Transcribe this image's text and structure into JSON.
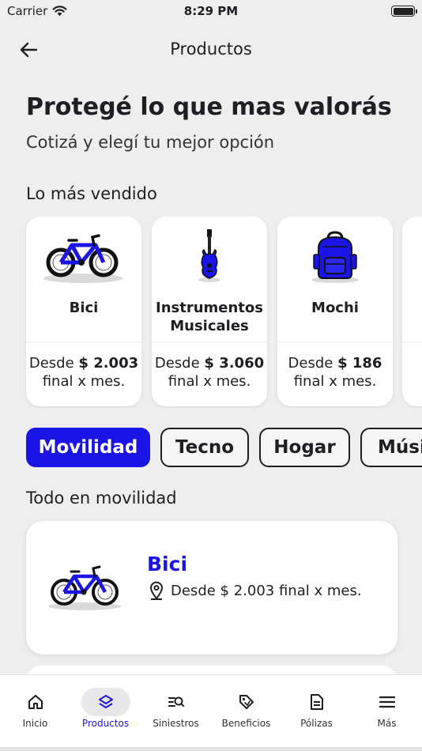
{
  "status_bar": {
    "carrier": "Carrier",
    "time": "8:29 PM"
  },
  "nav": {
    "title": "Productos"
  },
  "header": {
    "headline": "Protegé lo que mas valorás",
    "subheadline": "Cotizá y elegí tu mejor opción"
  },
  "best_sellers": {
    "title": "Lo más vendido",
    "items": [
      {
        "name": "Bici",
        "desde": "Desde",
        "price": "$ 2.003",
        "suffix": "final x mes."
      },
      {
        "name": "Instrumentos Musicales",
        "desde": "Desde",
        "price": "$ 3.060",
        "suffix": "final x mes."
      },
      {
        "name": "Mochi",
        "desde": "Desde",
        "price": "$ 186",
        "suffix": "final x mes."
      }
    ]
  },
  "categories": {
    "items": [
      {
        "label": "Movilidad",
        "active": true
      },
      {
        "label": "Tecno",
        "active": false
      },
      {
        "label": "Hogar",
        "active": false
      },
      {
        "label": "Músi",
        "active": false
      }
    ]
  },
  "category_section": {
    "title": "Todo en movilidad",
    "products": [
      {
        "name": "Bici",
        "description": "Desde $ 2.003 final x mes."
      }
    ]
  },
  "tab_bar": {
    "items": [
      {
        "label": "Inicio",
        "icon": "home-icon",
        "active": false
      },
      {
        "label": "Productos",
        "icon": "layers-icon",
        "active": true
      },
      {
        "label": "Siniestros",
        "icon": "search-list-icon",
        "active": false
      },
      {
        "label": "Beneficios",
        "icon": "tag-icon",
        "active": false
      },
      {
        "label": "Pólizas",
        "icon": "document-icon",
        "active": false
      },
      {
        "label": "Más",
        "icon": "menu-icon",
        "active": false
      }
    ]
  },
  "colors": {
    "accent": "#1b14e6",
    "background": "#efeeef",
    "card": "#ffffff",
    "text": "#1f1f23"
  }
}
